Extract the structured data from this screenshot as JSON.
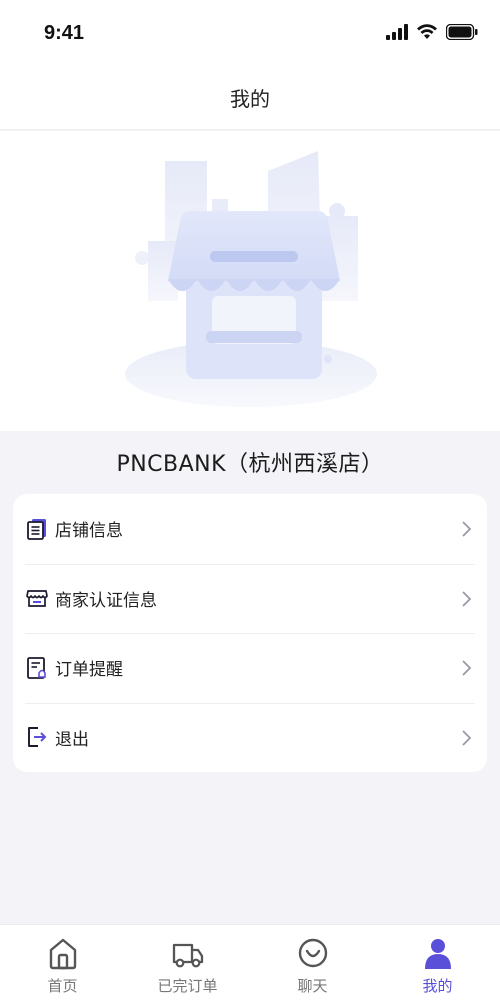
{
  "status_bar": {
    "time": "9:41"
  },
  "header": {
    "title": "我的"
  },
  "store": {
    "name": "PNCBANK（杭州西溪店）"
  },
  "menu": {
    "items": [
      {
        "label": "店铺信息",
        "icon": "document-icon"
      },
      {
        "label": "商家认证信息",
        "icon": "storefront-icon"
      },
      {
        "label": "订单提醒",
        "icon": "order-bell-icon"
      },
      {
        "label": "退出",
        "icon": "logout-icon"
      }
    ]
  },
  "tabs": [
    {
      "label": "首页",
      "icon": "home-icon",
      "active": false
    },
    {
      "label": "已完订单",
      "icon": "truck-icon",
      "active": false
    },
    {
      "label": "聊天",
      "icon": "chat-smile-icon",
      "active": false
    },
    {
      "label": "我的",
      "icon": "person-icon",
      "active": true
    }
  ],
  "colors": {
    "accent": "#5a4fd8",
    "illustration": "#d9def5",
    "background": "#f3f3f8"
  }
}
